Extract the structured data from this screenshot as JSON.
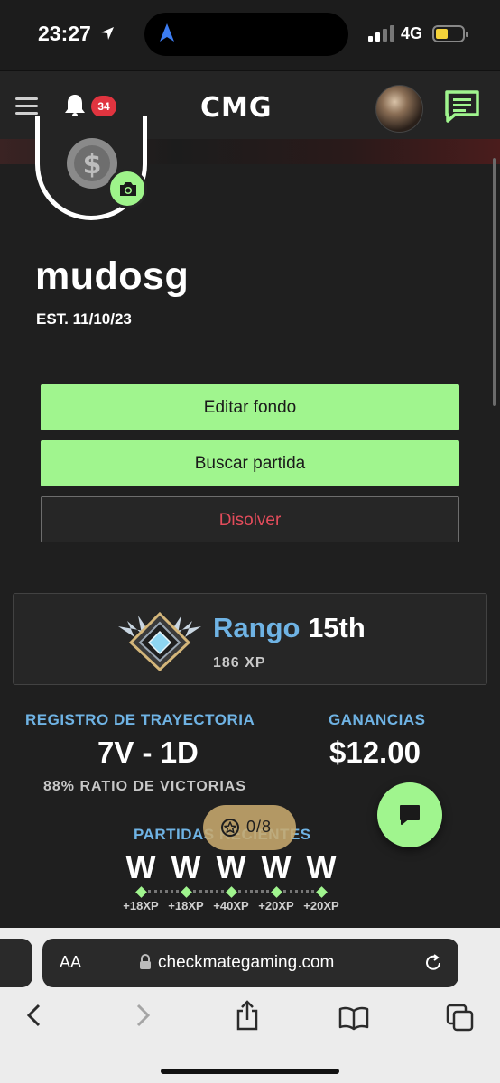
{
  "status_bar": {
    "time": "23:27",
    "network": "4G"
  },
  "header": {
    "logo": "CMG",
    "notification_count": "34"
  },
  "profile": {
    "username": "mudosg",
    "established": "EST. 11/10/23"
  },
  "buttons": {
    "edit_background": "Editar fondo",
    "find_match": "Buscar partida",
    "disband": "Disolver"
  },
  "rank": {
    "label": "Rango",
    "position": "15th",
    "xp": "186 XP"
  },
  "stats": {
    "track_record_label": "REGISTRO DE TRAYECTORIA",
    "record": "7V - 1D",
    "earnings_label": "GANANCIAS",
    "earnings": "$12.00",
    "win_ratio": "88% RATIO DE VICTORIAS"
  },
  "recent_matches": {
    "label": "PARTIDAS RECIENTES",
    "items": [
      {
        "result": "W",
        "xp": "+18XP"
      },
      {
        "result": "W",
        "xp": "+18XP"
      },
      {
        "result": "W",
        "xp": "+40XP"
      },
      {
        "result": "W",
        "xp": "+20XP"
      },
      {
        "result": "W",
        "xp": "+20XP"
      }
    ]
  },
  "progress_pill": {
    "text": "0/8"
  },
  "browser": {
    "text_size": "AA",
    "url": "checkmategaming.com"
  },
  "colors": {
    "accent_green": "#a0f58e",
    "accent_blue": "#6fb3e4",
    "danger": "#e34c5b"
  }
}
